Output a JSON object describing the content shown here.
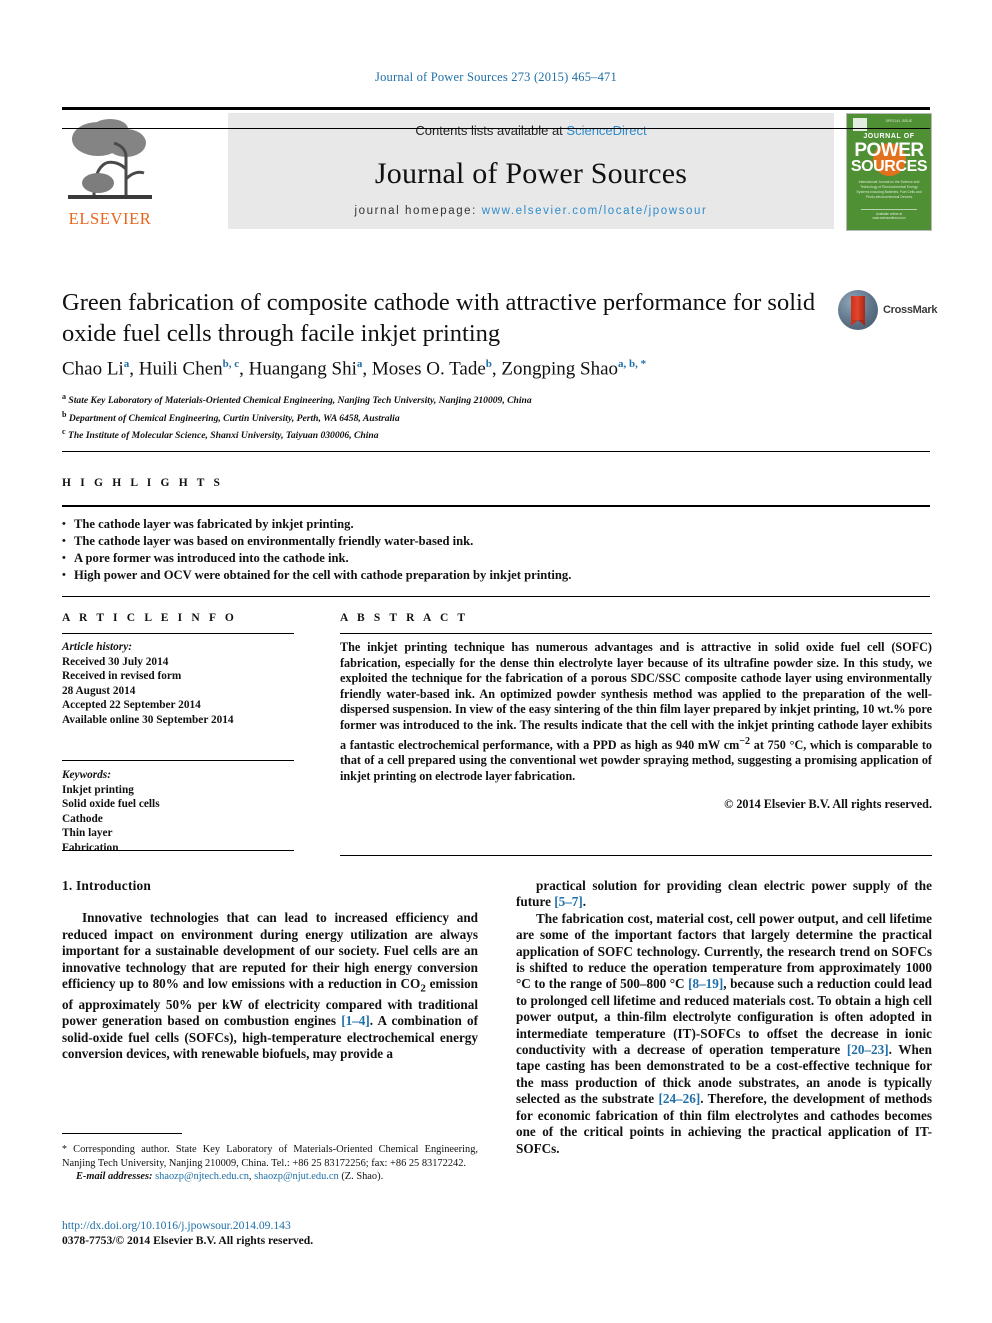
{
  "running_head": "Journal of Power Sources 273 (2015) 465–471",
  "masthead": {
    "contents_prefix": "Contents lists available at ",
    "sciencedirect": "ScienceDirect",
    "journal_title": "Journal of Power Sources",
    "homepage_label": "journal homepage: ",
    "homepage_url": "www.elsevier.com/locate/jpowsour",
    "publisher_logo_text": "ELSEVIER",
    "cover": {
      "top_small": "SPECIAL ISSUE",
      "journal_of": "JOURNAL OF",
      "power": "POWER",
      "sources": "SOURCES",
      "blurb": "International Journal on the Science and Technology of Electrochemical Energy Systems including Batteries, Fuel Cells and Photo-electrochemical Devices",
      "foot": "Available online at www.sciencedirect.com"
    }
  },
  "article": {
    "title": "Green fabrication of composite cathode with attractive performance for solid oxide fuel cells through facile inkjet printing",
    "crossmark_label": "CrossMark",
    "authors": [
      {
        "name": "Chao Li",
        "marks": "a"
      },
      {
        "name": "Huili Chen",
        "marks": "b, c"
      },
      {
        "name": "Huangang Shi",
        "marks": "a"
      },
      {
        "name": "Moses O. Tade",
        "marks": "b"
      },
      {
        "name": "Zongping Shao",
        "marks": "a, b, *"
      }
    ],
    "affiliations": [
      {
        "mark": "a",
        "text": "State Key Laboratory of Materials-Oriented Chemical Engineering, Nanjing Tech University, Nanjing 210009, China"
      },
      {
        "mark": "b",
        "text": "Department of Chemical Engineering, Curtin University, Perth, WA 6458, Australia"
      },
      {
        "mark": "c",
        "text": "The Institute of Molecular Science, Shanxi University, Taiyuan 030006, China"
      }
    ]
  },
  "highlights": {
    "heading": "H I G H L I G H T S",
    "items": [
      "The cathode layer was fabricated by inkjet printing.",
      "The cathode layer was based on environmentally friendly water-based ink.",
      "A pore former was introduced into the cathode ink.",
      "High power and OCV were obtained for the cell with cathode preparation by inkjet printing."
    ]
  },
  "article_info": {
    "heading": "A R T I C L E  I N F O",
    "history_label": "Article history:",
    "history": [
      "Received 30 July 2014",
      "Received in revised form",
      "28 August 2014",
      "Accepted 22 September 2014",
      "Available online 30 September 2014"
    ],
    "keywords_label": "Keywords:",
    "keywords": [
      "Inkjet printing",
      "Solid oxide fuel cells",
      "Cathode",
      "Thin layer",
      "Fabrication"
    ]
  },
  "abstract": {
    "heading": "A B S T R A C T",
    "text": "The inkjet printing technique has numerous advantages and is attractive in solid oxide fuel cell (SOFC) fabrication, especially for the dense thin electrolyte layer because of its ultrafine powder size. In this study, we exploited the technique for the fabrication of a porous SDC/SSC composite cathode layer using environmentally friendly water-based ink. An optimized powder synthesis method was applied to the preparation of the well-dispersed suspension. In view of the easy sintering of the thin film layer prepared by inkjet printing, 10 wt.% pore former was introduced to the ink. The results indicate that the cell with the inkjet printing cathode layer exhibits a fantastic electrochemical performance, with a PPD as high as 940 mW cm−2 at 750 °C, which is comparable to that of a cell prepared using the conventional wet powder spraying method, suggesting a promising application of inkjet printing on electrode layer fabrication.",
    "copyright": "© 2014 Elsevier B.V. All rights reserved."
  },
  "body": {
    "section_number_title": "1. Introduction",
    "left_paragraph": "Innovative technologies that can lead to increased efficiency and reduced impact on environment during energy utilization are always important for a sustainable development of our society. Fuel cells are an innovative technology that are reputed for their high energy conversion efficiency up to 80% and low emissions with a reduction in CO2 emission of approximately 50% per kW of electricity compared with traditional power generation based on combustion engines [1–4]. A combination of solid-oxide fuel cells (SOFCs), high-temperature electrochemical energy conversion devices, with renewable biofuels, may provide a",
    "right_paragraph_1": "practical solution for providing clean electric power supply of the future [5–7].",
    "right_paragraph_2": "The fabrication cost, material cost, cell power output, and cell lifetime are some of the important factors that largely determine the practical application of SOFC technology. Currently, the research trend on SOFCs is shifted to reduce the operation temperature from approximately 1000 °C to the range of 500–800 °C [8–19], because such a reduction could lead to prolonged cell lifetime and reduced materials cost. To obtain a high cell power output, a thin-film electrolyte configuration is often adopted in intermediate temperature (IT)-SOFCs to offset the decrease in ionic conductivity with a decrease of operation temperature [20–23]. When tape casting has been demonstrated to be a cost-effective technique for the mass production of thick anode substrates, an anode is typically selected as the substrate [24–26]. Therefore, the development of methods for economic fabrication of thin film electrolytes and cathodes becomes one of the critical points in achieving the practical application of IT-SOFCs."
  },
  "footnotes": {
    "corresponding": "Corresponding author. State Key Laboratory of Materials-Oriented Chemical Engineering, Nanjing Tech University, Nanjing 210009, China. Tel.: +86 25 83172256; fax: +86 25 83172242.",
    "email_label": "E-mail addresses:",
    "email_1": "shaozp@njtech.edu.cn",
    "email_2": "shaozp@njut.edu.cn",
    "email_attrib": "(Z. Shao).",
    "doi": "http://dx.doi.org/10.1016/j.jpowsour.2014.09.143",
    "issn_line": "0378-7753/© 2014 Elsevier B.V. All rights reserved."
  },
  "colors": {
    "link_blue": "#1f6fa8",
    "sciencedirect_blue": "#2e8ccb",
    "elsevier_orange": "#e8651d",
    "cover_green": "#4e9033",
    "cover_orange": "#e2711d"
  }
}
